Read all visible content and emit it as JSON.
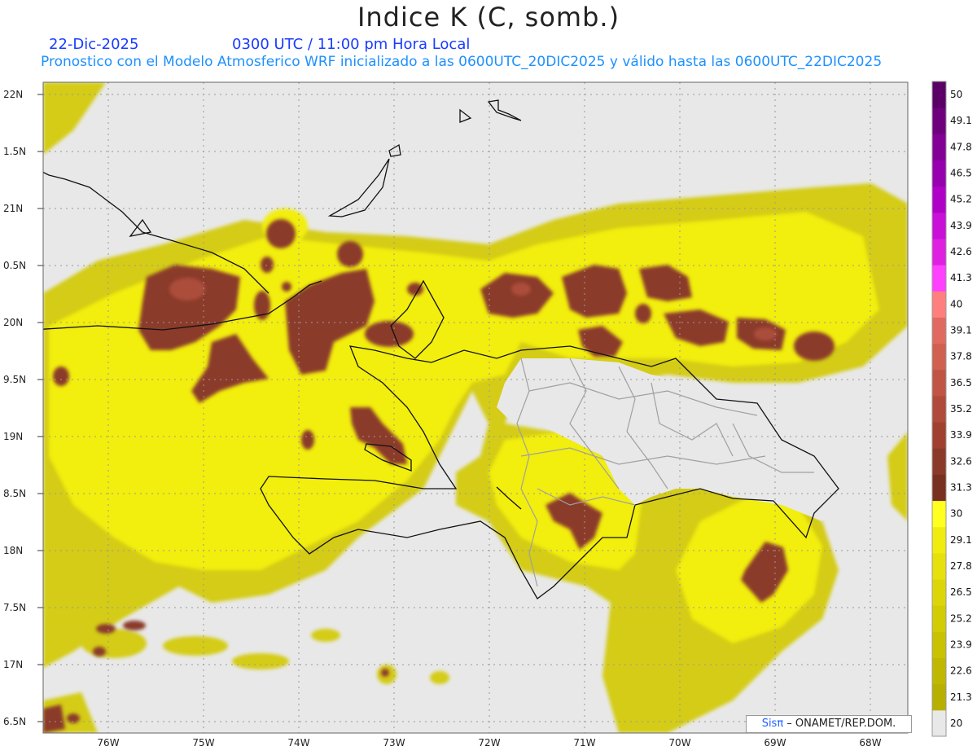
{
  "header": {
    "title": "Indice K (C, somb.)",
    "date": "22-Dic-2025",
    "time": "0300 UTC / 11:00 pm Hora Local",
    "subtitle": "Pronostico con el Modelo Atmosferico WRF inicializado a las 0600UTC_20DIC2025 y válido hasta las  0600UTC_22DIC2025"
  },
  "axes": {
    "lat_labels": [
      "22N",
      "1.5N",
      "21N",
      "0.5N",
      "20N",
      "9.5N",
      "19N",
      "8.5N",
      "18N",
      "7.5N",
      "17N",
      "6.5N"
    ],
    "lon_labels": [
      "76W",
      "75W",
      "74W",
      "73W",
      "72W",
      "71W",
      "70W",
      "69W",
      "68W"
    ]
  },
  "colorbar": {
    "labels": [
      "50",
      "49.1",
      "47.8",
      "46.5",
      "45.2",
      "43.9",
      "42.6",
      "41.3",
      "40",
      "39.1",
      "37.8",
      "36.5",
      "35.2",
      "33.9",
      "32.6",
      "31.3",
      "30",
      "29.1",
      "27.8",
      "26.5",
      "25.2",
      "23.9",
      "22.6",
      "21.3",
      "20"
    ],
    "colors": {
      "top_purple": "#5a0066",
      "magenta": "#e020e0",
      "pink": "#ff7f7f",
      "brown": "#8b3a2a",
      "yellow": "#ffff20",
      "olive": "#c8c000",
      "empty": "#e8e8e8"
    }
  },
  "credit": {
    "brand": "Sisπ",
    "text": " – ONAMET/REP.DOM."
  }
}
